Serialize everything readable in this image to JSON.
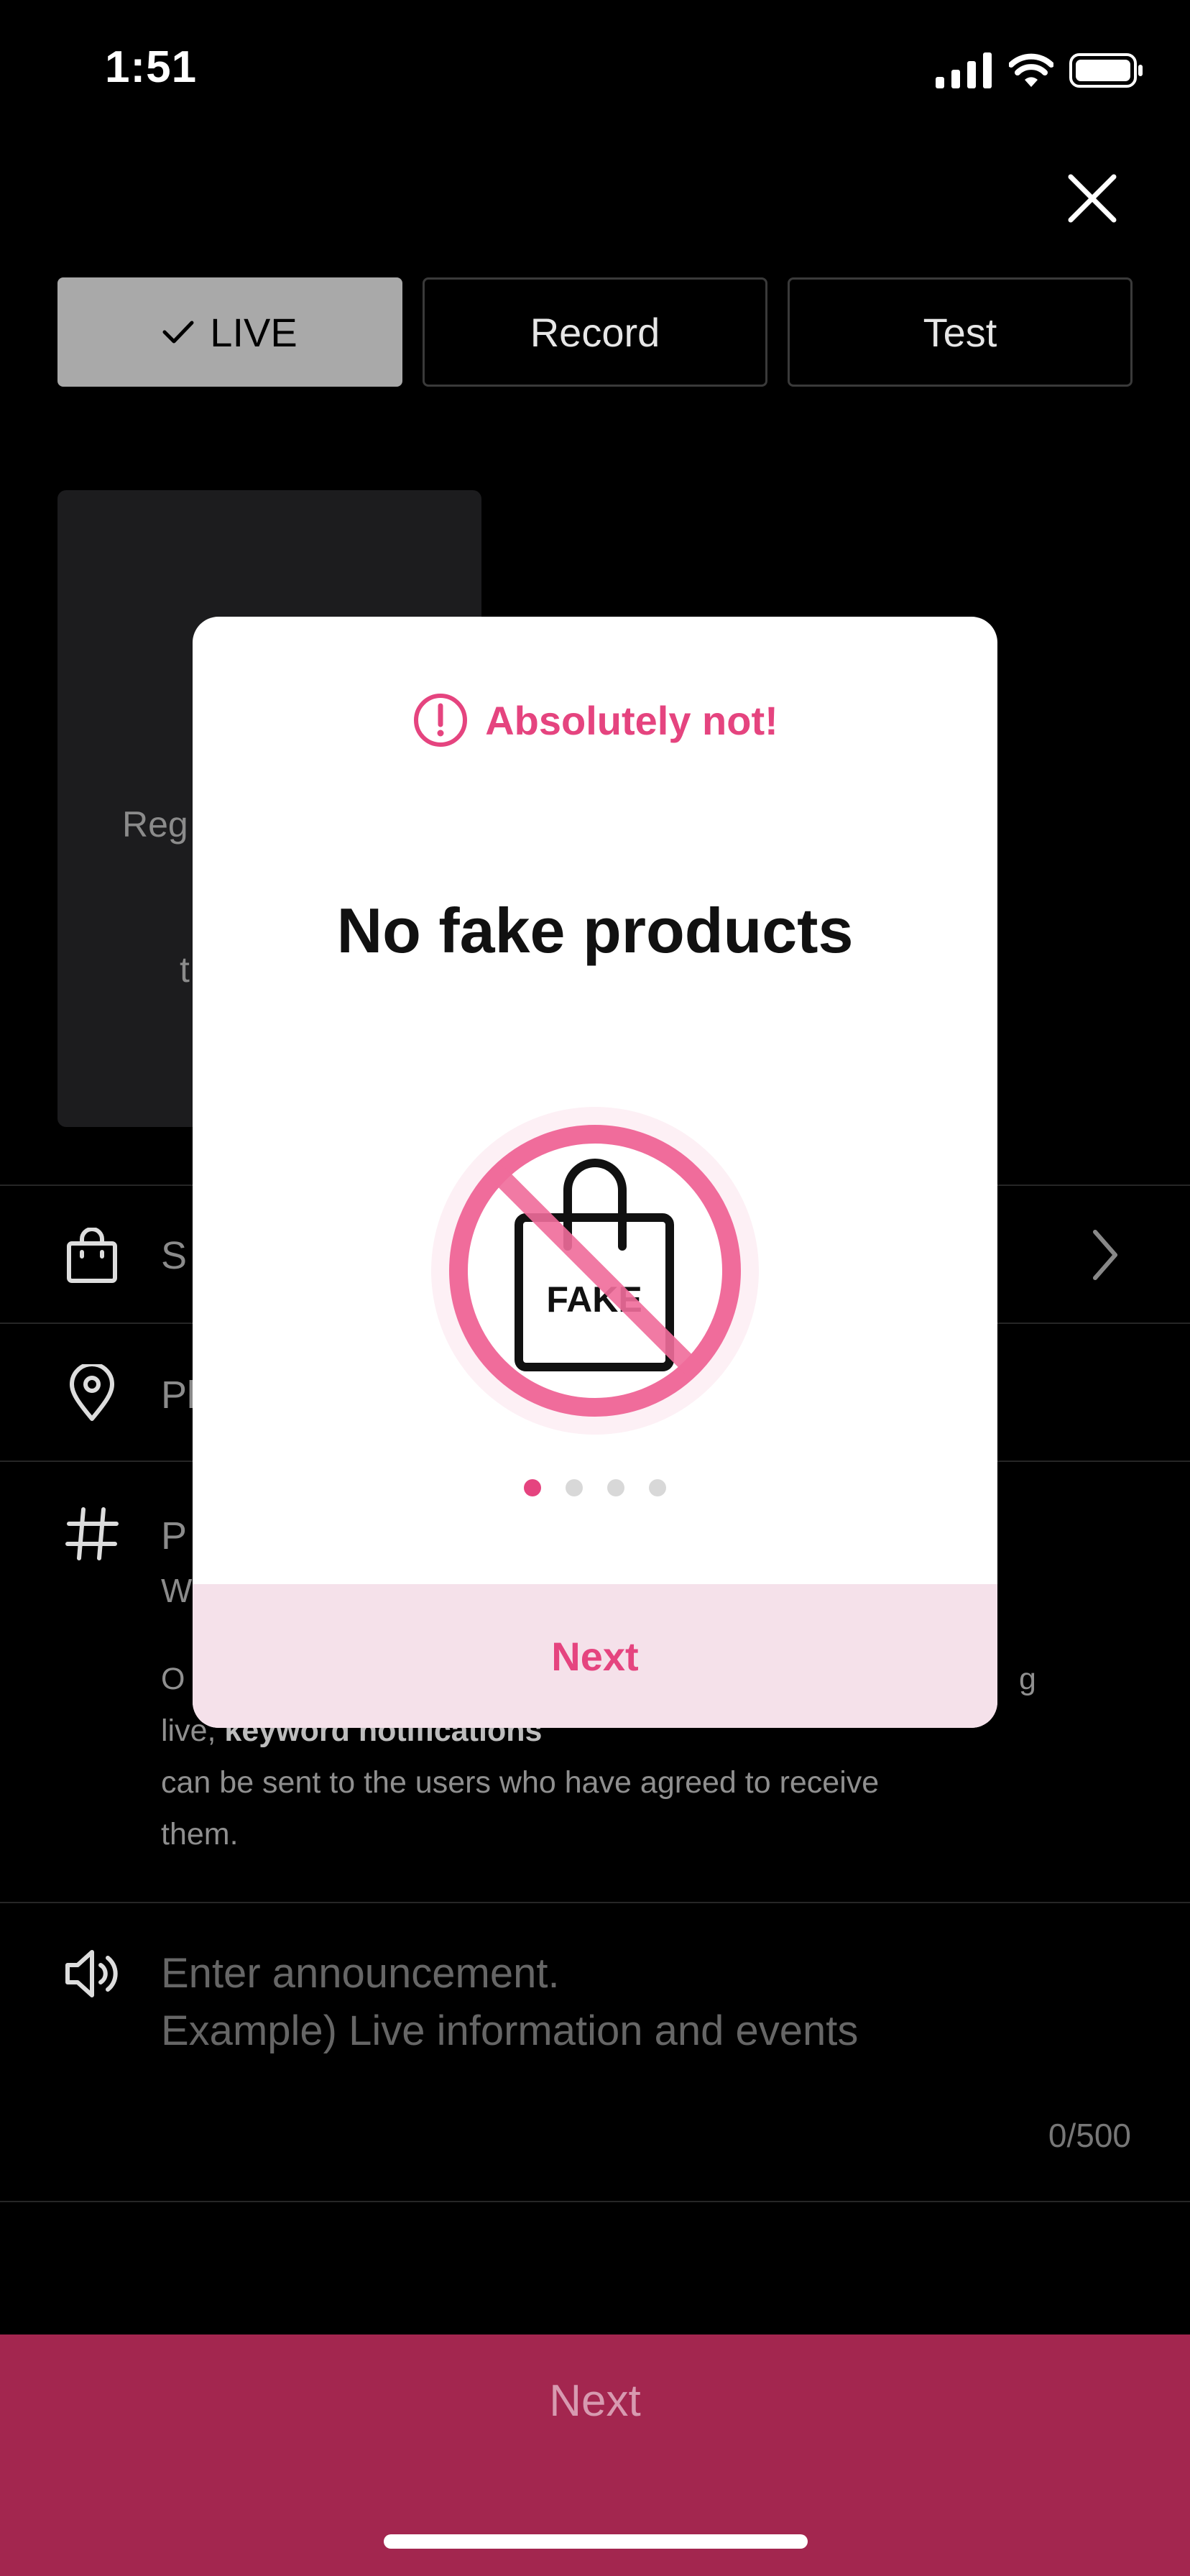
{
  "status": {
    "time": "1:51"
  },
  "tabs": [
    {
      "label": "LIVE",
      "active": true
    },
    {
      "label": "Record",
      "active": false
    },
    {
      "label": "Test",
      "active": false
    }
  ],
  "cover": {
    "text1": "Reg",
    "text2": "t"
  },
  "rows": {
    "product": {
      "label": "S",
      "icon": "shopping-bag-icon"
    },
    "location": {
      "label": "Pl",
      "icon": "location-pin-icon"
    },
    "tags": {
      "label_line1": "P",
      "label_line2": "W",
      "icon": "hashtag-icon"
    }
  },
  "keyword_note": {
    "line1_start": "O",
    "line1_end": "g",
    "line2_start": "live, ",
    "line2_bold": "keyword notifications",
    "line3": "can be sent to the users who have agreed to receive",
    "line4": "them."
  },
  "announcement": {
    "placeholder_line1": "Enter announcement.",
    "placeholder_line2": "Example) Live information and events",
    "counter": "0/500",
    "icon": "speaker-icon"
  },
  "bottom": {
    "next_label": "Next"
  },
  "modal": {
    "warning": "Absolutely not!",
    "title": "No fake products",
    "illustration_text": "FAKE",
    "page_index": 0,
    "page_count": 4,
    "next_label": "Next"
  },
  "colors": {
    "accent": "#e5447f",
    "bottom_bar": "#a3264f",
    "modal_button_bg": "#f5e1ea"
  }
}
